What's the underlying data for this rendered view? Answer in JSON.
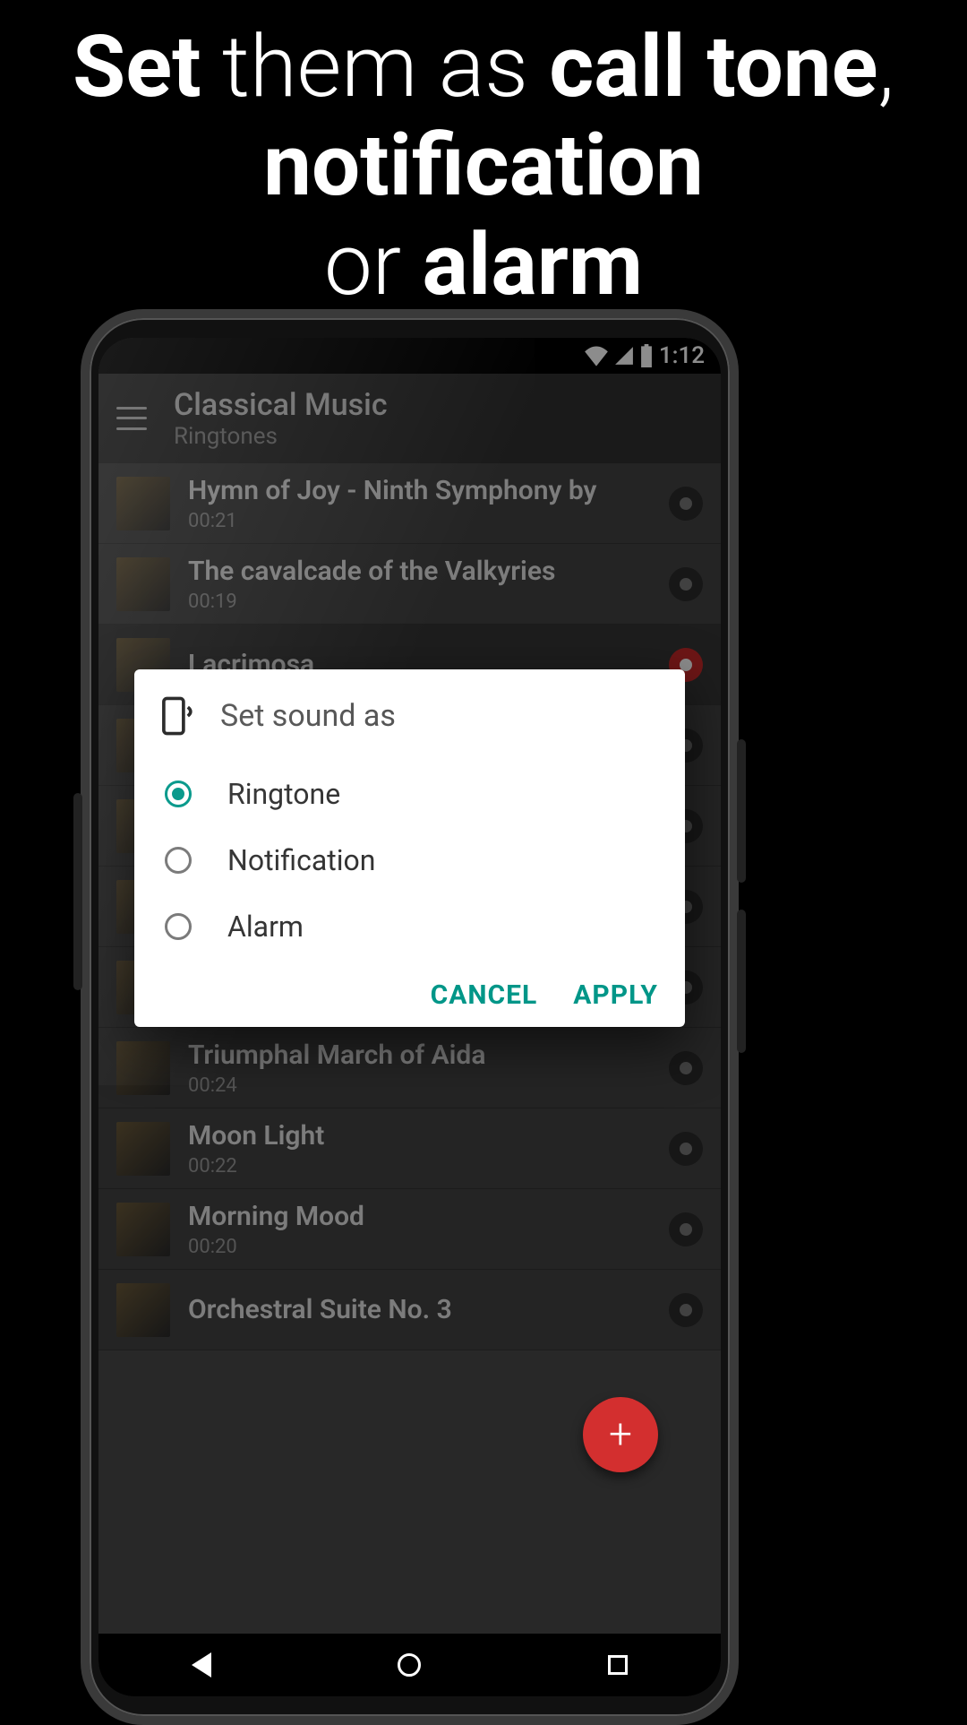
{
  "headline": {
    "w1": "Set",
    "w2": "them as",
    "w3": "call tone",
    "w4": ",",
    "w5": "notification",
    "w6": "or",
    "w7": "alarm"
  },
  "statusbar": {
    "time": "1:12"
  },
  "appbar": {
    "title": "Classical Music",
    "subtitle": "Ringtones"
  },
  "tracks": [
    {
      "title": "Hymn of Joy - Ninth Symphony by",
      "time": "00:21",
      "active": false
    },
    {
      "title": "The cavalcade of the Valkyries",
      "time": "00:19",
      "active": false
    },
    {
      "title": "Lacrimosa",
      "time": "",
      "active": true
    },
    {
      "title": "",
      "time": "",
      "active": false
    },
    {
      "title": "",
      "time": "",
      "active": false
    },
    {
      "title": "",
      "time": "",
      "active": false
    },
    {
      "title": "",
      "time": "",
      "active": false
    },
    {
      "title": "Triumphal March of Aida",
      "time": "00:24",
      "active": false
    },
    {
      "title": "Moon Light",
      "time": "00:22",
      "active": false
    },
    {
      "title": "Morning Mood",
      "time": "00:20",
      "active": false
    },
    {
      "title": "Orchestral Suite No. 3",
      "time": "",
      "active": false
    }
  ],
  "dialog": {
    "title": "Set sound as",
    "options": [
      {
        "label": "Ringtone",
        "selected": true
      },
      {
        "label": "Notification",
        "selected": false
      },
      {
        "label": "Alarm",
        "selected": false
      }
    ],
    "cancel": "CANCEL",
    "apply": "APPLY"
  },
  "fab": {
    "glyph": "+"
  },
  "colors": {
    "accent": "#009688",
    "fab": "#d32f2f"
  }
}
